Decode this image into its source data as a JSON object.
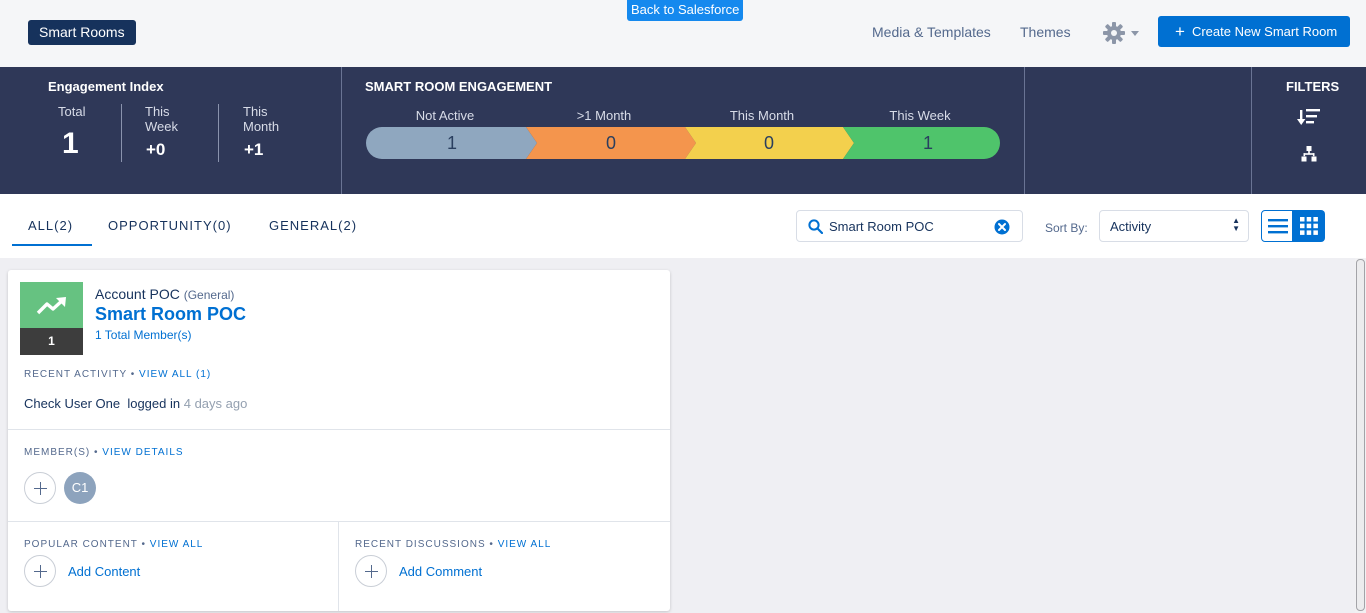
{
  "header": {
    "brand": "Smart Rooms",
    "back_button": "Back to Salesforce",
    "nav": {
      "media": "Media & Templates",
      "themes": "Themes"
    },
    "create_button": "Create New Smart Room",
    "create_plus": "+"
  },
  "engagement_index": {
    "title": "Engagement Index",
    "total": {
      "label": "Total",
      "value": "1"
    },
    "this_week": {
      "label_line1": "This",
      "label_line2": "Week",
      "value": "+0"
    },
    "this_month": {
      "label_line1": "This",
      "label_line2": "Month",
      "value": "+1"
    }
  },
  "smart_room_engagement": {
    "title": "SMART ROOM ENGAGEMENT",
    "stages": [
      {
        "label": "Not Active",
        "value": "1",
        "color": "#8fa7bf"
      },
      {
        "label": ">1 Month",
        "value": "0",
        "color": "#f4954d"
      },
      {
        "label": "This Month",
        "value": "0",
        "color": "#f3d04d"
      },
      {
        "label": "This Week",
        "value": "1",
        "color": "#4fc46b"
      }
    ]
  },
  "filters": {
    "title": "FILTERS",
    "icons": [
      "sort-filter-icon",
      "hierarchy-icon"
    ]
  },
  "tabs": [
    {
      "label": "ALL(2)",
      "active": true
    },
    {
      "label": "OPPORTUNITY(0)",
      "active": false
    },
    {
      "label": "GENERAL(2)",
      "active": false
    }
  ],
  "search": {
    "value": "Smart Room POC"
  },
  "sort": {
    "label": "Sort By:",
    "selected": "Activity"
  },
  "card": {
    "badge_count": "1",
    "account": "Account POC",
    "room_type": "(General)",
    "title": "Smart Room POC",
    "members_total": "1 Total Member(s)",
    "recent_activity": {
      "label": "RECENT ACTIVITY",
      "link": "VIEW ALL (1)"
    },
    "activity": {
      "user": "Check User One",
      "action": "logged in",
      "ago": "4 days ago"
    },
    "members": {
      "label": "MEMBER(S)",
      "link": "VIEW DETAILS",
      "avatars": [
        "C1"
      ]
    },
    "popular_content": {
      "label": "POPULAR CONTENT",
      "link": "VIEW ALL",
      "add": "Add Content"
    },
    "recent_discussions": {
      "label": "RECENT DISCUSSIONS",
      "link": "VIEW ALL",
      "add": "Add Comment"
    }
  },
  "colors": {
    "brand_navy": "#16325c",
    "accent_blue": "#0070d2",
    "band_bg": "#2f3858"
  }
}
